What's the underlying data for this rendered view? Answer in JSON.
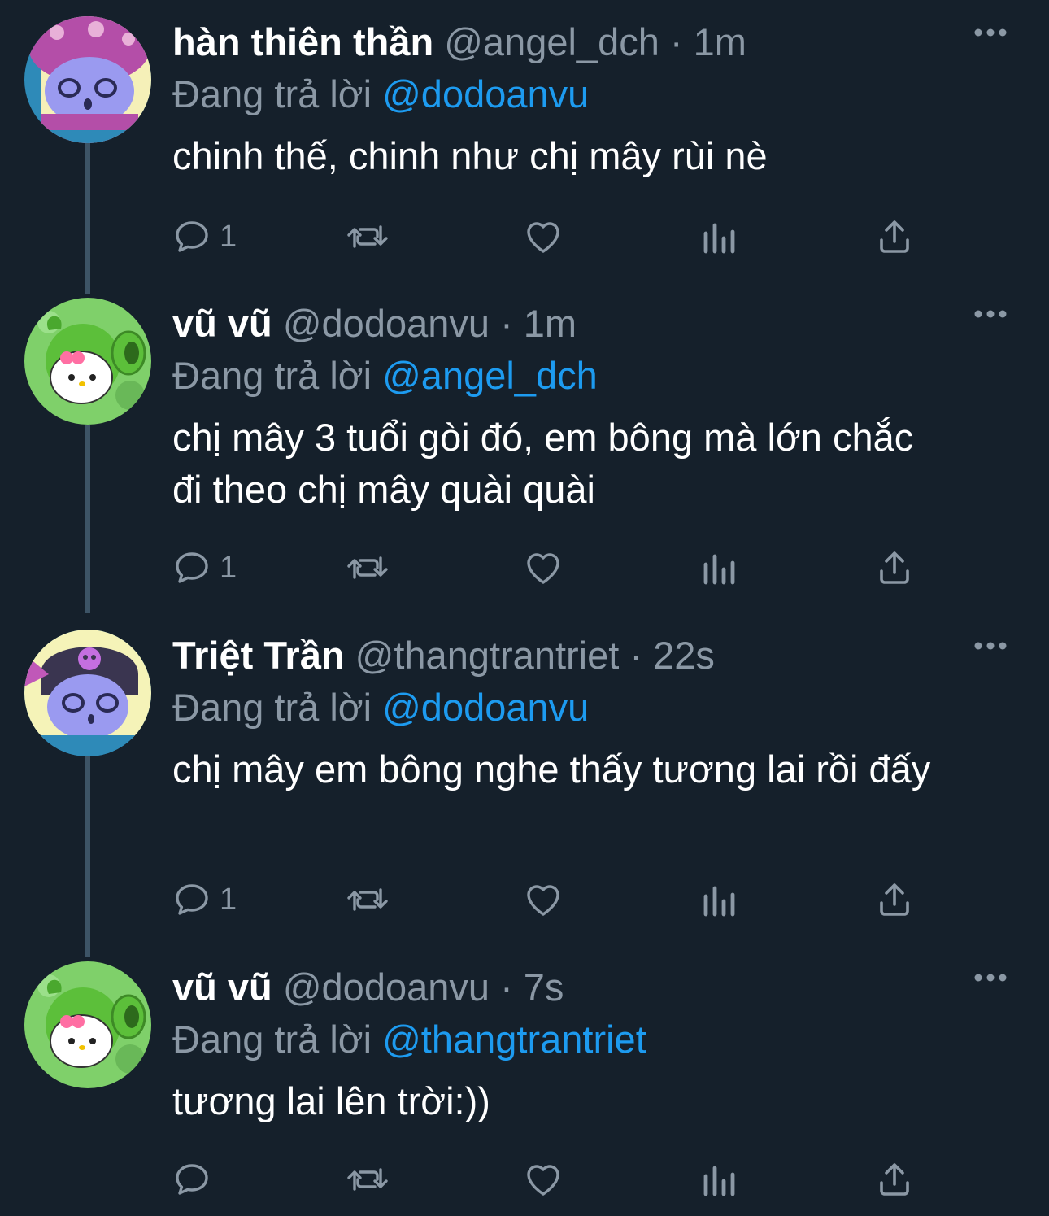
{
  "colors": {
    "background": "#15202b",
    "text_primary": "#ffffff",
    "text_secondary": "#8b98a5",
    "accent": "#1d9bf0",
    "thread_line": "#3d5466"
  },
  "tweets": [
    {
      "display_name": "hàn thiên thần",
      "handle": "@angel_dch",
      "separator": "·",
      "time": "1m",
      "reply_prefix": "Đang trả lời",
      "reply_to": "@dodoanvu",
      "body": "chinh thế, chinh như chị mây rùi nè",
      "reply_count": "1",
      "avatar": "purple-hooded-character-avatar"
    },
    {
      "display_name": "vũ vũ",
      "handle": "@dodoanvu",
      "separator": "·",
      "time": "1m",
      "reply_prefix": "Đang trả lời",
      "reply_to": "@angel_dch",
      "body": "chị mây 3 tuổi gòi đó, em bông mà lớn chắc đi theo chị mây quài quài",
      "reply_count": "1",
      "avatar": "hello-kitty-peashooter-avatar"
    },
    {
      "display_name": "Triệt Trần",
      "handle": "@thangtrantriet",
      "separator": "·",
      "time": "22s",
      "reply_prefix": "Đang trả lời",
      "reply_to": "@dodoanvu",
      "body": "chị mây em bông nghe thấy tương lai rồi đấy",
      "reply_count": "1",
      "avatar": "kuromi-character-avatar"
    },
    {
      "display_name": "vũ vũ",
      "handle": "@dodoanvu",
      "separator": "·",
      "time": "7s",
      "reply_prefix": "Đang trả lời",
      "reply_to": "@thangtrantriet",
      "body": "tương lai lên trời:))",
      "reply_count": "",
      "avatar": "hello-kitty-peashooter-avatar"
    }
  ],
  "icons": {
    "more": "more-horizontal-icon",
    "reply": "reply-bubble-icon",
    "retweet": "retweet-icon",
    "like": "heart-icon",
    "views": "views-bar-chart-icon",
    "share": "share-upload-icon"
  }
}
